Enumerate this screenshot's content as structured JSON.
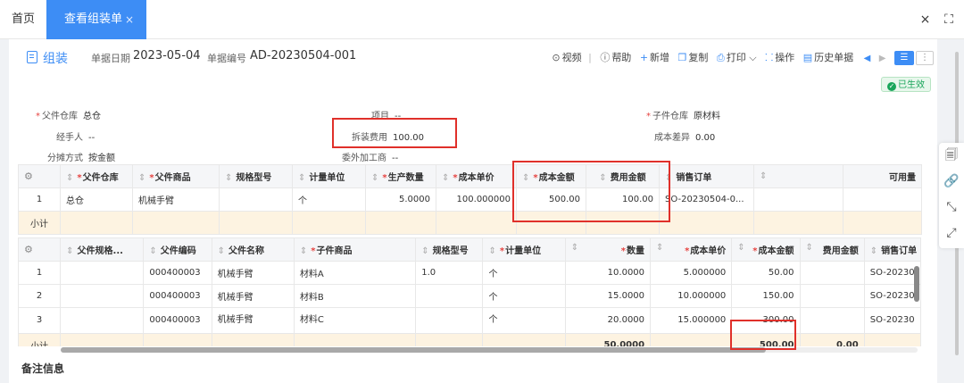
{
  "tabs": {
    "home": "首页",
    "active": "查看组装单",
    "close": "×"
  },
  "window": {
    "close": "×",
    "fullscreen": "⛶"
  },
  "header": {
    "title": "组装",
    "date_label": "单据日期",
    "date_value": "2023-05-04",
    "code_label": "单据编号",
    "code_value": "AD-20230504-001"
  },
  "toolbar": {
    "video": "视频",
    "help": "帮助",
    "add": "新增",
    "copy": "复制",
    "print": "打印",
    "operate": "操作",
    "history": "历史单据"
  },
  "status": "已生效",
  "form": {
    "parent_wh_label": "父件仓库",
    "parent_wh_value": "总仓",
    "project_label": "项目",
    "project_value": "--",
    "child_wh_label": "子件仓库",
    "child_wh_value": "原材料",
    "handler_label": "经手人",
    "handler_value": "--",
    "fee_label": "拆装费用",
    "fee_value": "100.00",
    "cost_diff_label": "成本差异",
    "cost_diff_value": "0.00",
    "alloc_label": "分摊方式",
    "alloc_value": "按金额",
    "outsource_label": "委外加工商",
    "outsource_value": "--"
  },
  "table1": {
    "headers": [
      "父件仓库",
      "父件商品",
      "规格型号",
      "计量单位",
      "生产数量",
      "成本单价",
      "成本金额",
      "费用金额",
      "销售订单",
      "",
      "可用量"
    ],
    "row": {
      "idx": "1",
      "wh": "总仓",
      "product": "机械手臂",
      "spec": "",
      "unit": "个",
      "qty": "5.0000",
      "price": "100.000000",
      "amount": "500.00",
      "fee": "100.00",
      "order": "SO-20230504-0..."
    },
    "subtotal": "小计"
  },
  "table2": {
    "headers": [
      "父件规格...",
      "父件编码",
      "父件名称",
      "子件商品",
      "规格型号",
      "计量单位",
      "数量",
      "成本单价",
      "成本金额",
      "费用金额",
      "销售订单"
    ],
    "rows": [
      {
        "idx": "1",
        "pcode": "000400003",
        "pname": "机械手臂",
        "child": "材料A",
        "spec": "1.0",
        "unit": "个",
        "qty": "10.0000",
        "price": "5.000000",
        "amount": "50.00",
        "fee": "",
        "order": "SO-20230"
      },
      {
        "idx": "2",
        "pcode": "000400003",
        "pname": "机械手臂",
        "child": "材料B",
        "spec": "",
        "unit": "个",
        "qty": "15.0000",
        "price": "10.000000",
        "amount": "150.00",
        "fee": "",
        "order": "SO-20230"
      },
      {
        "idx": "3",
        "pcode": "000400003",
        "pname": "机械手臂",
        "child": "材料C",
        "spec": "",
        "unit": "个",
        "qty": "20.0000",
        "price": "15.000000",
        "amount": "300.00",
        "fee": "",
        "order": "SO-20230"
      }
    ],
    "subtotal": {
      "label": "小计",
      "qty": "50.0000",
      "amount": "500.00",
      "fee": "0.00"
    }
  },
  "remark": "备注信息",
  "colors": {
    "accent": "#3d8df5",
    "required": "#e64340",
    "highlight": "#e0302a",
    "subtotal_bg": "#fdf3e1",
    "status_green": "#19a55a"
  },
  "icons": [
    "doc-icon",
    "video-icon",
    "help-icon",
    "plus-icon",
    "copy-icon",
    "print-icon",
    "grid-icon",
    "history-icon",
    "gear-icon",
    "search-doc-icon",
    "link-icon",
    "collapse-icon",
    "expand-icon"
  ]
}
